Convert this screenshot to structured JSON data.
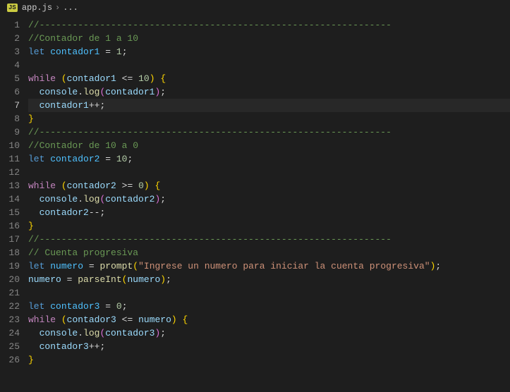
{
  "breadcrumb": {
    "badge": "JS",
    "file": "app.js",
    "sep": "›",
    "more": "..."
  },
  "activeLine": 7,
  "lines": [
    {
      "n": 1,
      "t": [
        [
          "c",
          "//----------------------------------------------------------------"
        ]
      ]
    },
    {
      "n": 2,
      "t": [
        [
          "c",
          "//Contador de 1 a 10"
        ]
      ]
    },
    {
      "n": 3,
      "t": [
        [
          "k",
          "let"
        ],
        [
          "o",
          " "
        ],
        [
          "vw",
          "contador1"
        ],
        [
          "o",
          " "
        ],
        [
          "o",
          "="
        ],
        [
          "o",
          " "
        ],
        [
          "n",
          "1"
        ],
        [
          "o",
          ";"
        ]
      ]
    },
    {
      "n": 4,
      "t": []
    },
    {
      "n": 5,
      "t": [
        [
          "cf",
          "while"
        ],
        [
          "o",
          " "
        ],
        [
          "b1",
          "("
        ],
        [
          "v",
          "contador1"
        ],
        [
          "o",
          " "
        ],
        [
          "o",
          "<="
        ],
        [
          "o",
          " "
        ],
        [
          "n",
          "10"
        ],
        [
          "b1",
          ")"
        ],
        [
          "o",
          " "
        ],
        [
          "br",
          "{"
        ]
      ]
    },
    {
      "n": 6,
      "t": [
        [
          "o",
          "  "
        ],
        [
          "obj",
          "console"
        ],
        [
          "o",
          "."
        ],
        [
          "fn",
          "log"
        ],
        [
          "b2",
          "("
        ],
        [
          "v",
          "contador1"
        ],
        [
          "b2",
          ")"
        ],
        [
          "o",
          ";"
        ]
      ]
    },
    {
      "n": 7,
      "t": [
        [
          "o",
          "  "
        ],
        [
          "v",
          "contador1"
        ],
        [
          "o",
          "++"
        ],
        [
          "o",
          ";"
        ]
      ]
    },
    {
      "n": 8,
      "t": [
        [
          "br",
          "}"
        ]
      ]
    },
    {
      "n": 9,
      "t": [
        [
          "c",
          "//----------------------------------------------------------------"
        ]
      ]
    },
    {
      "n": 10,
      "t": [
        [
          "c",
          "//Contador de 10 a 0"
        ]
      ]
    },
    {
      "n": 11,
      "t": [
        [
          "k",
          "let"
        ],
        [
          "o",
          " "
        ],
        [
          "vw",
          "contador2"
        ],
        [
          "o",
          " "
        ],
        [
          "o",
          "="
        ],
        [
          "o",
          " "
        ],
        [
          "n",
          "10"
        ],
        [
          "o",
          ";"
        ]
      ]
    },
    {
      "n": 12,
      "t": []
    },
    {
      "n": 13,
      "t": [
        [
          "cf",
          "while"
        ],
        [
          "o",
          " "
        ],
        [
          "b1",
          "("
        ],
        [
          "v",
          "contador2"
        ],
        [
          "o",
          " "
        ],
        [
          "o",
          ">="
        ],
        [
          "o",
          " "
        ],
        [
          "n",
          "0"
        ],
        [
          "b1",
          ")"
        ],
        [
          "o",
          " "
        ],
        [
          "b1",
          "{"
        ]
      ]
    },
    {
      "n": 14,
      "t": [
        [
          "o",
          "  "
        ],
        [
          "obj",
          "console"
        ],
        [
          "o",
          "."
        ],
        [
          "fn",
          "log"
        ],
        [
          "b2",
          "("
        ],
        [
          "v",
          "contador2"
        ],
        [
          "b2",
          ")"
        ],
        [
          "o",
          ";"
        ]
      ]
    },
    {
      "n": 15,
      "t": [
        [
          "o",
          "  "
        ],
        [
          "v",
          "contador2"
        ],
        [
          "o",
          "--"
        ],
        [
          "o",
          ";"
        ]
      ]
    },
    {
      "n": 16,
      "t": [
        [
          "b1",
          "}"
        ]
      ]
    },
    {
      "n": 17,
      "t": [
        [
          "c",
          "//----------------------------------------------------------------"
        ]
      ]
    },
    {
      "n": 18,
      "t": [
        [
          "c",
          "// Cuenta progresiva"
        ]
      ]
    },
    {
      "n": 19,
      "t": [
        [
          "k",
          "let"
        ],
        [
          "o",
          " "
        ],
        [
          "vw",
          "numero"
        ],
        [
          "o",
          " "
        ],
        [
          "o",
          "="
        ],
        [
          "o",
          " "
        ],
        [
          "fn",
          "prompt"
        ],
        [
          "b1",
          "("
        ],
        [
          "s",
          "\"Ingrese un numero para iniciar la cuenta progresiva\""
        ],
        [
          "b1",
          ")"
        ],
        [
          "o",
          ";"
        ]
      ]
    },
    {
      "n": 20,
      "t": [
        [
          "v",
          "numero"
        ],
        [
          "o",
          " "
        ],
        [
          "o",
          "="
        ],
        [
          "o",
          " "
        ],
        [
          "fn",
          "parseInt"
        ],
        [
          "b1",
          "("
        ],
        [
          "v",
          "numero"
        ],
        [
          "b1",
          ")"
        ],
        [
          "o",
          ";"
        ]
      ]
    },
    {
      "n": 21,
      "t": []
    },
    {
      "n": 22,
      "t": [
        [
          "k",
          "let"
        ],
        [
          "o",
          " "
        ],
        [
          "vw",
          "contador3"
        ],
        [
          "o",
          " "
        ],
        [
          "o",
          "="
        ],
        [
          "o",
          " "
        ],
        [
          "n",
          "0"
        ],
        [
          "o",
          ";"
        ]
      ]
    },
    {
      "n": 23,
      "t": [
        [
          "cf",
          "while"
        ],
        [
          "o",
          " "
        ],
        [
          "b1",
          "("
        ],
        [
          "v",
          "contador3"
        ],
        [
          "o",
          " "
        ],
        [
          "o",
          "<="
        ],
        [
          "o",
          " "
        ],
        [
          "v",
          "numero"
        ],
        [
          "b1",
          ")"
        ],
        [
          "o",
          " "
        ],
        [
          "b1",
          "{"
        ]
      ]
    },
    {
      "n": 24,
      "t": [
        [
          "o",
          "  "
        ],
        [
          "obj",
          "console"
        ],
        [
          "o",
          "."
        ],
        [
          "fn",
          "log"
        ],
        [
          "b2",
          "("
        ],
        [
          "v",
          "contador3"
        ],
        [
          "b2",
          ")"
        ],
        [
          "o",
          ";"
        ]
      ]
    },
    {
      "n": 25,
      "t": [
        [
          "o",
          "  "
        ],
        [
          "v",
          "contador3"
        ],
        [
          "o",
          "++"
        ],
        [
          "o",
          ";"
        ]
      ]
    },
    {
      "n": 26,
      "t": [
        [
          "b1",
          "}"
        ]
      ]
    }
  ]
}
